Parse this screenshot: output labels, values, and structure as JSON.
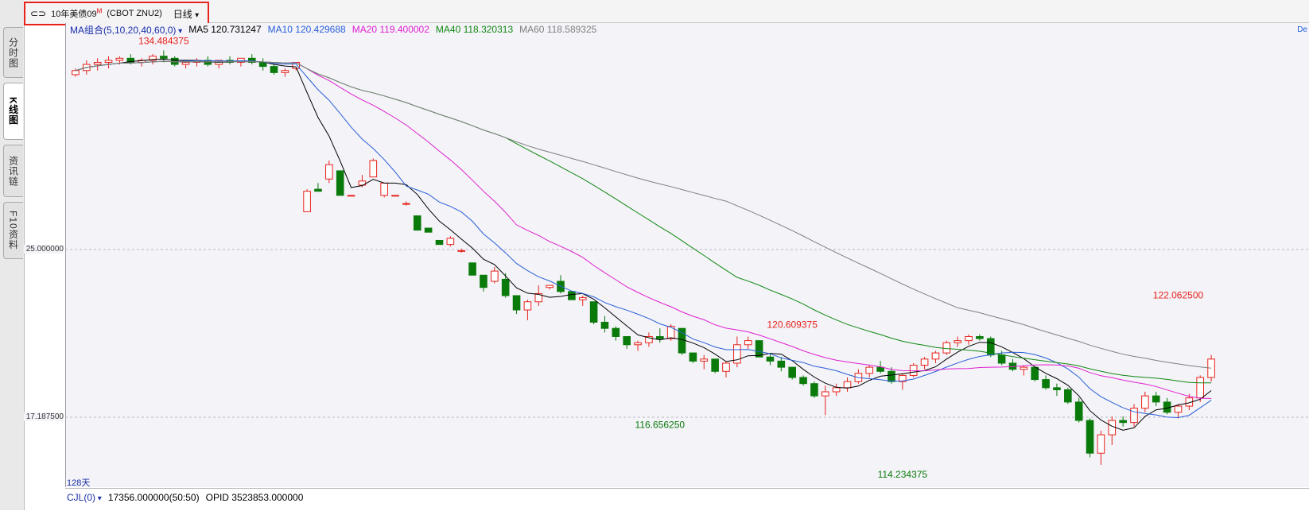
{
  "header": {
    "symbol": "10年美债09",
    "symbol_sup": "M",
    "code": "(CBOT ZNU2)",
    "period": "日线"
  },
  "side_tabs": [
    "分时图",
    "K线图",
    "资讯链",
    "F10资料"
  ],
  "ma_legend": {
    "group": "MA组合(5,10,20,40,60,0)",
    "items": [
      {
        "label": "MA5 120.731247",
        "color": "#000000"
      },
      {
        "label": "MA10 120.429688",
        "color": "#2a5fd8"
      },
      {
        "label": "MA20 119.400002",
        "color": "#e020d0"
      },
      {
        "label": "MA40 118.320313",
        "color": "#118811"
      },
      {
        "label": "MA60 118.589325",
        "color": "#808080"
      }
    ]
  },
  "edge_label": "De",
  "period_count": "128天",
  "volume_row": {
    "indicator": "CJL(0)",
    "volume": "17356.000000(50:50)",
    "opid": "OPID 3523853.000000"
  },
  "colors": {
    "up": "#e8221c",
    "down": "#0a7a0a"
  },
  "chart_data": {
    "type": "candlestick",
    "y_tick_labels": [
      "25.000000",
      "17.187500"
    ],
    "ylim": [
      113.8,
      135.2
    ],
    "annotations": [
      {
        "text": "134.484375",
        "x": 8,
        "y": 134.48,
        "color": "#e8221c"
      },
      {
        "text": "116.656250",
        "x": 53,
        "y": 116.66,
        "color": "#0a7a0a"
      },
      {
        "text": "120.609375",
        "x": 65,
        "y": 120.61,
        "color": "#e8221c"
      },
      {
        "text": "114.234375",
        "x": 75,
        "y": 114.23,
        "color": "#0a7a0a"
      },
      {
        "text": "122.062500",
        "x": 100,
        "y": 122.06,
        "color": "#e8221c"
      }
    ],
    "candles": [
      [
        133.3,
        133.6,
        133.2,
        133.5
      ],
      [
        133.5,
        134.0,
        133.3,
        133.8
      ],
      [
        133.8,
        134.1,
        133.5,
        133.9
      ],
      [
        133.9,
        134.2,
        133.6,
        134.0
      ],
      [
        134.0,
        134.2,
        133.8,
        134.1
      ],
      [
        134.1,
        134.3,
        133.8,
        133.9
      ],
      [
        133.9,
        134.1,
        133.7,
        134.0
      ],
      [
        134.0,
        134.3,
        133.8,
        134.2
      ],
      [
        134.2,
        134.48,
        133.9,
        134.1
      ],
      [
        134.1,
        134.2,
        133.7,
        133.8
      ],
      [
        133.8,
        134.0,
        133.6,
        133.9
      ],
      [
        133.9,
        134.1,
        133.7,
        134.0
      ],
      [
        134.0,
        134.2,
        133.7,
        133.8
      ],
      [
        133.8,
        134.0,
        133.6,
        134.0
      ],
      [
        134.0,
        134.2,
        133.8,
        133.9
      ],
      [
        133.9,
        134.1,
        133.7,
        134.1
      ],
      [
        134.1,
        134.3,
        133.8,
        133.9
      ],
      [
        133.9,
        134.1,
        133.5,
        133.7
      ],
      [
        133.7,
        133.8,
        133.3,
        133.4
      ],
      [
        133.4,
        133.6,
        133.2,
        133.5
      ],
      [
        133.6,
        133.9,
        133.5,
        133.9
      ],
      [
        126.6,
        127.7,
        126.6,
        127.6
      ],
      [
        127.7,
        128.0,
        127.6,
        127.6
      ],
      [
        128.2,
        129.1,
        128.0,
        128.9
      ],
      [
        128.6,
        128.6,
        127.4,
        127.4
      ],
      [
        127.4,
        127.4,
        127.4,
        127.4
      ],
      [
        127.9,
        128.4,
        127.8,
        128.1
      ],
      [
        128.3,
        129.2,
        128.3,
        129.1
      ],
      [
        127.4,
        128.0,
        127.3,
        128.0
      ],
      [
        127.4,
        127.4,
        127.4,
        127.4
      ],
      [
        127.0,
        127.1,
        126.9,
        127.0
      ],
      [
        126.4,
        126.4,
        125.7,
        125.7
      ],
      [
        125.8,
        125.8,
        125.6,
        125.6
      ],
      [
        125.2,
        125.2,
        125.0,
        125.0
      ],
      [
        125.0,
        125.4,
        124.9,
        125.3
      ],
      [
        124.7,
        124.8,
        124.6,
        124.7
      ],
      [
        124.1,
        124.1,
        123.5,
        123.5
      ],
      [
        123.5,
        123.5,
        122.7,
        122.9
      ],
      [
        123.2,
        123.9,
        123.1,
        123.7
      ],
      [
        123.3,
        123.6,
        122.4,
        122.5
      ],
      [
        122.5,
        122.5,
        121.6,
        121.8
      ],
      [
        121.8,
        122.3,
        121.3,
        122.2
      ],
      [
        122.2,
        123.0,
        122.0,
        122.6
      ],
      [
        122.9,
        123.0,
        122.8,
        123.0
      ],
      [
        123.2,
        123.5,
        122.6,
        122.7
      ],
      [
        122.7,
        122.7,
        122.3,
        122.3
      ],
      [
        122.3,
        122.5,
        122.0,
        122.4
      ],
      [
        122.2,
        122.2,
        121.1,
        121.2
      ],
      [
        121.2,
        121.5,
        120.7,
        120.9
      ],
      [
        120.9,
        121.0,
        120.3,
        120.5
      ],
      [
        120.5,
        120.5,
        119.9,
        120.1
      ],
      [
        120.1,
        120.3,
        119.8,
        120.2
      ],
      [
        120.2,
        120.7,
        120.0,
        120.5
      ],
      [
        120.5,
        120.9,
        120.2,
        120.4
      ],
      [
        120.4,
        121.1,
        120.3,
        121.0
      ],
      [
        120.9,
        120.9,
        119.6,
        119.7
      ],
      [
        119.7,
        119.7,
        119.2,
        119.3
      ],
      [
        119.3,
        119.6,
        118.9,
        119.4
      ],
      [
        119.4,
        119.4,
        118.7,
        118.8
      ],
      [
        118.8,
        119.3,
        118.5,
        119.2
      ],
      [
        119.2,
        120.5,
        119.0,
        120.1
      ],
      [
        120.1,
        120.5,
        119.9,
        120.3
      ],
      [
        120.3,
        120.3,
        119.5,
        119.5
      ],
      [
        119.5,
        119.7,
        119.1,
        119.3
      ],
      [
        119.3,
        119.5,
        118.8,
        119.0
      ],
      [
        119.0,
        119.0,
        118.4,
        118.5
      ],
      [
        118.5,
        118.6,
        118.1,
        118.2
      ],
      [
        118.2,
        118.3,
        117.5,
        117.6
      ],
      [
        117.6,
        118.1,
        116.66,
        117.8
      ],
      [
        117.8,
        118.2,
        117.6,
        118.0
      ],
      [
        118.0,
        118.5,
        117.8,
        118.3
      ],
      [
        118.3,
        118.9,
        118.2,
        118.7
      ],
      [
        118.7,
        119.1,
        118.5,
        119.0
      ],
      [
        119.0,
        119.3,
        118.7,
        118.8
      ],
      [
        118.8,
        119.0,
        118.2,
        118.3
      ],
      [
        118.3,
        118.7,
        117.9,
        118.6
      ],
      [
        118.6,
        119.2,
        118.5,
        119.1
      ],
      [
        119.1,
        119.5,
        118.9,
        119.4
      ],
      [
        119.4,
        119.8,
        119.2,
        119.7
      ],
      [
        119.7,
        120.3,
        119.6,
        120.2
      ],
      [
        120.2,
        120.5,
        120.0,
        120.3
      ],
      [
        120.3,
        120.6,
        120.1,
        120.5
      ],
      [
        120.5,
        120.61,
        120.3,
        120.4
      ],
      [
        120.4,
        120.5,
        119.5,
        119.6
      ],
      [
        119.6,
        119.8,
        119.1,
        119.2
      ],
      [
        119.2,
        119.4,
        118.8,
        118.9
      ],
      [
        118.9,
        119.1,
        118.6,
        119.0
      ],
      [
        119.0,
        119.0,
        118.3,
        118.4
      ],
      [
        118.4,
        118.6,
        117.9,
        118.0
      ],
      [
        118.0,
        118.2,
        117.6,
        117.9
      ],
      [
        117.9,
        118.0,
        117.2,
        117.3
      ],
      [
        117.3,
        117.5,
        116.3,
        116.4
      ],
      [
        116.4,
        116.5,
        114.6,
        114.8
      ],
      [
        114.8,
        115.9,
        114.23,
        115.7
      ],
      [
        115.7,
        116.6,
        115.2,
        116.4
      ],
      [
        116.4,
        116.6,
        116.1,
        116.3
      ],
      [
        116.3,
        117.2,
        116.1,
        117.0
      ],
      [
        117.0,
        117.8,
        116.8,
        117.6
      ],
      [
        117.6,
        117.8,
        117.1,
        117.3
      ],
      [
        117.3,
        117.5,
        116.7,
        116.8
      ],
      [
        116.8,
        117.2,
        116.5,
        117.1
      ],
      [
        117.1,
        117.7,
        116.9,
        117.5
      ],
      [
        117.5,
        118.6,
        117.3,
        118.5
      ],
      [
        118.5,
        119.6,
        118.3,
        119.4
      ]
    ]
  }
}
